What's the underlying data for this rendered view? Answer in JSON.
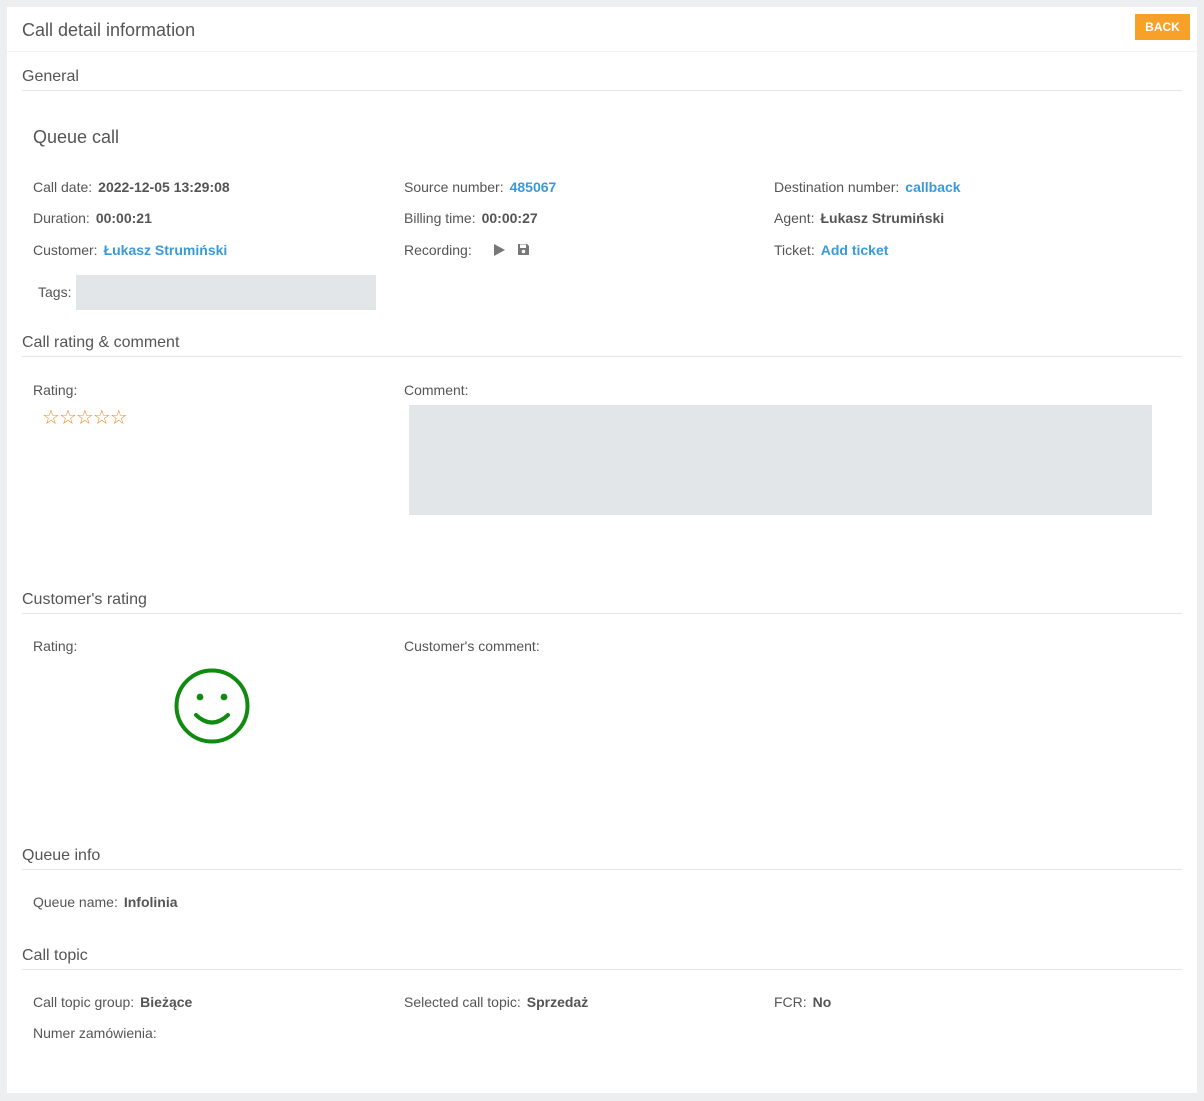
{
  "header": {
    "title": "Call detail information",
    "back_label": "BACK"
  },
  "general": {
    "section_title": "General",
    "call_type": "Queue call",
    "call_date": {
      "label": "Call date:",
      "value": "2022-12-05 13:29:08"
    },
    "source_number": {
      "label": "Source number:",
      "value": "485067"
    },
    "destination_number": {
      "label": "Destination number:",
      "value": "callback"
    },
    "duration": {
      "label": "Duration:",
      "value": "00:00:21"
    },
    "billing_time": {
      "label": "Billing time:",
      "value": "00:00:27"
    },
    "agent": {
      "label": "Agent:",
      "value": "Łukasz Strumiński"
    },
    "customer": {
      "label": "Customer:",
      "value": "Łukasz Strumiński"
    },
    "recording": {
      "label": "Recording:",
      "icons": [
        "play-icon",
        "save-icon"
      ]
    },
    "ticket": {
      "label": "Ticket:",
      "value": "Add ticket"
    },
    "tags": {
      "label": "Tags:"
    }
  },
  "call_rating": {
    "section_title": "Call rating & comment",
    "rating_label": "Rating:",
    "rating_value": 0,
    "rating_max": 5,
    "comment_label": "Comment:"
  },
  "customer_rating": {
    "section_title": "Customer's rating",
    "rating_label": "Rating:",
    "rating_icon": "smiley-icon",
    "comment_label": "Customer's comment:"
  },
  "queue_info": {
    "section_title": "Queue info",
    "queue_name": {
      "label": "Queue name:",
      "value": "Infolinia"
    }
  },
  "call_topic": {
    "section_title": "Call topic",
    "topic_group": {
      "label": "Call topic group:",
      "value": "Bieżące"
    },
    "selected_topic": {
      "label": "Selected call topic:",
      "value": "Sprzedaż"
    },
    "fcr": {
      "label": "FCR:",
      "value": "No"
    },
    "order_number": {
      "label": "Numer zamówienia:"
    }
  },
  "colors": {
    "accent": "#f7a12b",
    "link": "#3a9ad9",
    "star": "#ea8f2a",
    "smiley": "#118a11",
    "box": "#e3e6e8"
  }
}
